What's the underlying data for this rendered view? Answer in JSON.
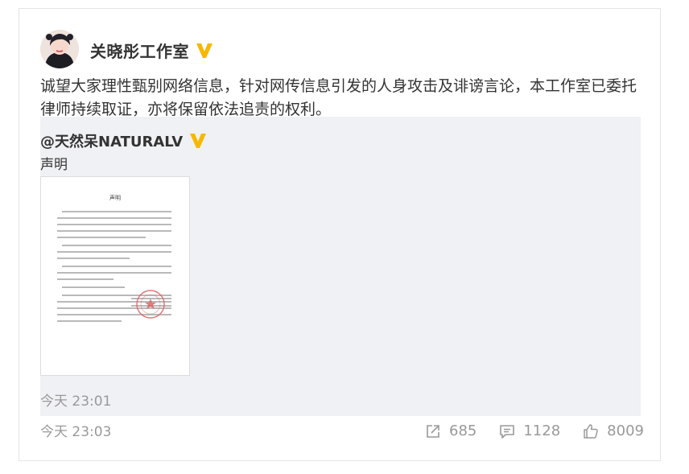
{
  "post": {
    "author": "关晓彤工作室",
    "text": "诚望大家理性甄别网络信息，针对网传信息引发的人身攻击及诽谤言论，本工作室已委托律师持续取证，亦将保留依法追责的权利。",
    "time": "今天 23:03"
  },
  "repost": {
    "author": "@天然呆NATURALV",
    "text": "声明",
    "time": "今天 23:01",
    "document": {
      "title": "声明"
    }
  },
  "actions": {
    "share_count": "685",
    "comment_count": "1128",
    "like_count": "8009"
  },
  "icons": {
    "verified": "verified-v-icon",
    "share": "share-icon",
    "comment": "comment-icon",
    "like": "thumbs-up-icon"
  },
  "colors": {
    "verified_badge": "#f6b800",
    "repost_background": "#f0f1f4",
    "meta_text": "#999999",
    "seal": "#e05a5a"
  }
}
